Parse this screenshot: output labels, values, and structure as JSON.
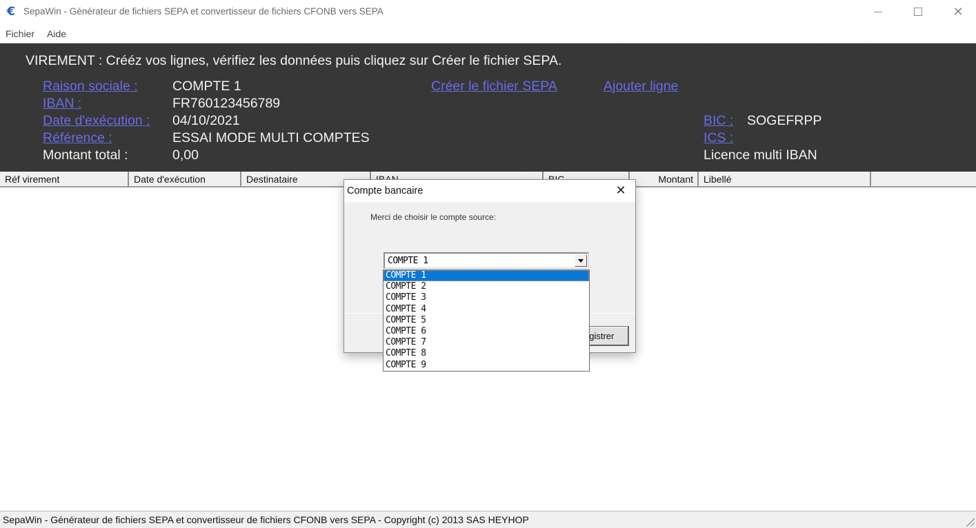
{
  "window": {
    "title": "SepaWin - Générateur de fichiers SEPA et convertisseur de fichiers CFONB vers SEPA",
    "icon": "euro-icon",
    "controls": {
      "minimize": "minimize-icon",
      "maximize": "maximize-icon",
      "close": "close-icon"
    }
  },
  "menu": {
    "items": [
      "Fichier",
      "Aide"
    ]
  },
  "header": {
    "instruction": "VIREMENT : Crééz vos lignes, vérifiez les données puis cliquez sur Créer le fichier SEPA.",
    "fields": {
      "raison_sociale": {
        "label": "Raison sociale :",
        "value": "COMPTE 1"
      },
      "iban": {
        "label": "IBAN :",
        "value": "FR760123456789"
      },
      "date_execution": {
        "label": "Date d'exécution :",
        "value": "04/10/2021"
      },
      "reference": {
        "label": "Référence :",
        "value": "ESSAI MODE MULTI COMPTES"
      },
      "montant_total": {
        "label": "Montant total :",
        "value": "0,00"
      },
      "bic": {
        "label": "BIC :",
        "value": "SOGEFRPP"
      },
      "ics": {
        "label": "ICS :",
        "value": ""
      }
    },
    "actions": {
      "create_file": "Créer le fichier SEPA",
      "add_line": "Ajouter ligne"
    },
    "license": "Licence multi IBAN"
  },
  "table": {
    "columns": [
      "Réf virement",
      "Date d'exécution",
      "Destinataire",
      "IBAN",
      "BIC",
      "Montant",
      "Libellé",
      ""
    ],
    "rows": []
  },
  "status_bar": "SepaWin - Générateur de fichiers SEPA et convertisseur de fichiers CFONB vers SEPA - Copyright (c) 2013 SAS HEYHOP",
  "dialog": {
    "title": "Compte bancaire",
    "prompt": "Merci de choisir le compte source:",
    "combo_value": "COMPTE 1",
    "options": [
      "COMPTE 1",
      "COMPTE 2",
      "COMPTE 3",
      "COMPTE 4",
      "COMPTE 5",
      "COMPTE 6",
      "COMPTE 7",
      "COMPTE 8",
      "COMPTE 9"
    ],
    "selected_index": 0,
    "button_label": "Enregistrer",
    "button_visible_text": "egistrer"
  },
  "colors": {
    "header_bg": "#363636",
    "link": "#6a6ae8",
    "selection": "#0a78d7"
  }
}
